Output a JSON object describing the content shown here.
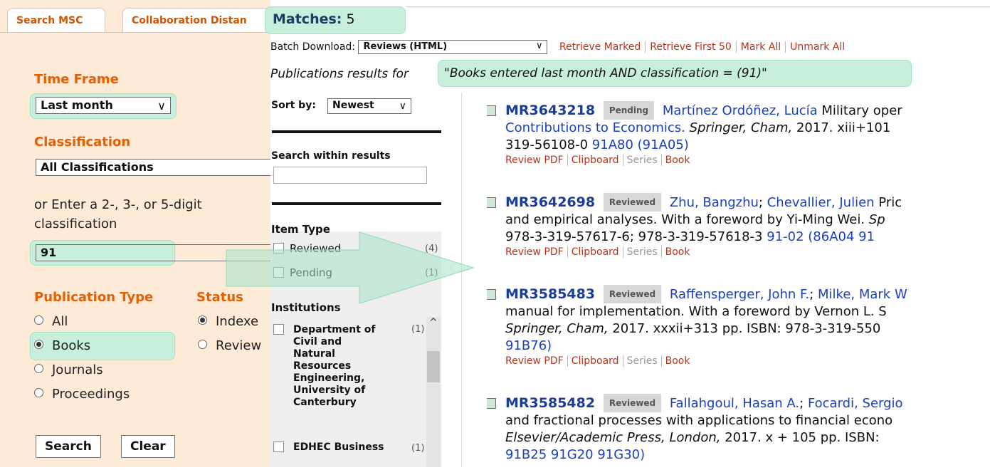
{
  "tabs": [
    {
      "label": "Search MSC"
    },
    {
      "label": "Collaboration Distan"
    }
  ],
  "left": {
    "time_frame": {
      "title": "Time Frame",
      "value": "Last month"
    },
    "classification": {
      "title": "Classification",
      "value": "All Classifications",
      "or_enter_line1": "or Enter a 2-, 3-, or 5-digit",
      "or_enter_line2": "classification",
      "code_value": "91"
    },
    "publication_type": {
      "title": "Publication Type",
      "options": [
        "All",
        "Books",
        "Journals",
        "Proceedings"
      ],
      "selected": "Books"
    },
    "status": {
      "title": "Status",
      "options": [
        "Indexe",
        "Review"
      ],
      "selected": "Indexe"
    },
    "buttons": {
      "search": "Search",
      "clear": "Clear"
    }
  },
  "header": {
    "matches_label": "Matches:",
    "matches_count": "5",
    "batch_label": "Batch Download:",
    "batch_value": "Reviews (HTML)",
    "actions": [
      "Retrieve Marked",
      "Retrieve First 50",
      "Mark All",
      "Unmark All"
    ],
    "pub_results_prefix": "Publications results for",
    "query": "\"Books entered last month AND classification = (91)\""
  },
  "filter": {
    "sort_label": "Sort by:",
    "sort_value": "Newest",
    "search_within": "Search within results",
    "item_type_title": "Item Type",
    "item_types": [
      {
        "label": "Reviewed",
        "count": "(4)"
      },
      {
        "label": "Pending",
        "count": "(1)"
      }
    ],
    "institutions_title": "Institutions",
    "institutions": [
      {
        "label": "Department of Civil and Natural Resources Engineering, University of Canterbury",
        "count": "(1)"
      },
      {
        "label": "EDHEC Business",
        "count": "(1)"
      }
    ]
  },
  "results": [
    {
      "mr": "MR3643218",
      "status": "Pending",
      "authors": "Martínez Ordóñez, Lucía",
      "line1_tail": " Military oper",
      "line2": "Contributions to Economics.",
      "line2_italic": " Springer, Cham,",
      "line2_tail": " 2017. xiii+101",
      "line3": "319-56108-0",
      "classes": " 91A80 (91A05)",
      "actions": [
        "Review PDF",
        "Clipboard",
        "Series",
        "Book"
      ]
    },
    {
      "mr": "MR3642698",
      "status": "Reviewed",
      "authors": "Zhu, Bangzhu",
      "authors2": "Chevallier, Julien",
      "line1_tail": " Pric",
      "line2": "and empirical analyses. With a foreword by Yi-Ming Wei.",
      "line2_italic": " Sp",
      "line3": "978-3-319-57617-6; 978-3-319-57618-3",
      "classes": " 91-02 (86A04 91",
      "actions": [
        "Review PDF",
        "Clipboard",
        "Series",
        "Book"
      ]
    },
    {
      "mr": "MR3585483",
      "status": "Reviewed",
      "authors": "Raffensperger, John F.",
      "authors2": "Milke, Mark W",
      "line2": "manual for implementation. With a foreword by Vernon L. S",
      "line3_italic": "Springer, Cham,",
      "line3": " 2017. xxxii+313 pp. ISBN: 978-3-319-550",
      "line4": "91B76)",
      "actions": [
        "Review PDF",
        "Clipboard",
        "Series",
        "Book"
      ]
    },
    {
      "mr": "MR3585482",
      "status": "Reviewed",
      "authors": "Fallahgoul, Hasan A.",
      "authors2": "Focardi, Sergio",
      "line2": "and fractional processes with applications to financial econo",
      "line3_italic": "Elsevier/Academic Press, London,",
      "line3": " 2017. x + 105 pp. ISBN:",
      "line4": "91B25 91G20 91G30)"
    }
  ],
  "colors": {
    "orange_title": "#e85d00",
    "highlight": "#c8eedc",
    "link_blue": "#1a3fbf",
    "action_red": "#b8321a",
    "left_bg": "#fdebd7"
  }
}
